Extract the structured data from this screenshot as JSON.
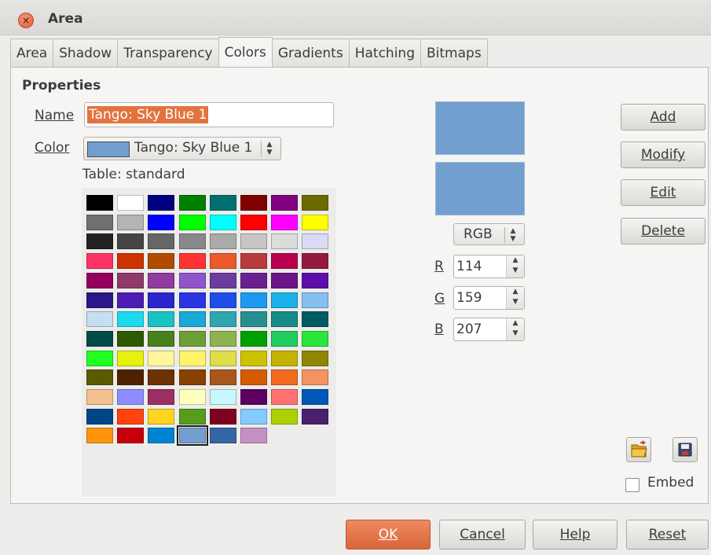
{
  "window": {
    "title": "Area"
  },
  "tabs": [
    "Area",
    "Shadow",
    "Transparency",
    "Colors",
    "Gradients",
    "Hatching",
    "Bitmaps"
  ],
  "active_tab": "Colors",
  "properties": {
    "heading": "Properties",
    "name_label": "Name",
    "name_value": "Tango: Sky Blue 1",
    "color_label": "Color",
    "color_value": "Tango: Sky Blue 1",
    "table_label": "Table: standard"
  },
  "color_model": {
    "mode": "RGB",
    "r_label": "R",
    "r_value": "114",
    "g_label": "G",
    "g_value": "159",
    "b_label": "B",
    "b_value": "207"
  },
  "preview_color": "#729fcf",
  "buttons": {
    "add": "Add",
    "modify": "Modify",
    "edit": "Edit",
    "delete": "Delete",
    "ok": "OK",
    "cancel": "Cancel",
    "help": "Help",
    "reset": "Reset"
  },
  "embed_label": "Embed",
  "palette": [
    [
      "#000000",
      "#ffffff",
      "#000080",
      "#008000",
      "#007070",
      "#800000",
      "#800080",
      "#6b6b00"
    ],
    [
      "#707070",
      "#b4b4b4",
      "#0000ff",
      "#00ff00",
      "#00ffff",
      "#ff0000",
      "#ff00ff",
      "#ffff00"
    ],
    [
      "#222222",
      "#444444",
      "#666666",
      "#888888",
      "#aaaaaa",
      "#c6c6c6",
      "#dcdcdc",
      "#dadaf5"
    ],
    [
      "#ff3366",
      "#cc3300",
      "#b04b00",
      "#ff3333",
      "#ea5a2c",
      "#b83a3a",
      "#b8004f",
      "#951a3f"
    ],
    [
      "#95005f",
      "#8f3a6b",
      "#8f3b9f",
      "#9055cc",
      "#6c3d9d",
      "#6b2091",
      "#6c148a",
      "#5e0eab"
    ],
    [
      "#2a1888",
      "#4e1bb5",
      "#2a26cc",
      "#2a34e3",
      "#1d4ee8",
      "#1d99f2",
      "#1ab2e8",
      "#84c1f0"
    ],
    [
      "#c5def1",
      "#1bd9ef",
      "#1bc2c2",
      "#1aa8d6",
      "#2ea6b0",
      "#268f92",
      "#168a86",
      "#005c63"
    ],
    [
      "#004a47",
      "#2d5a00",
      "#48811c",
      "#6d9e3a",
      "#8cb34f",
      "#00a000",
      "#1fcc5e",
      "#2ae63a"
    ],
    [
      "#22ff22",
      "#e5f20b",
      "#fff59a",
      "#fff36a",
      "#dfde4a",
      "#ccc200",
      "#c4b200",
      "#8f8700"
    ],
    [
      "#5a5a00",
      "#4e2200",
      "#6e3200",
      "#894000",
      "#a8561e",
      "#d45c00",
      "#f26a1f",
      "#f59261"
    ],
    [
      "#f2c18f",
      "#8c8cff",
      "#9c2e62",
      "#ffffc0",
      "#c8f7ff",
      "#5c0062",
      "#ff7070",
      "#0057b7"
    ],
    [
      "#004586",
      "#ff420e",
      "#ffd320",
      "#579d1c",
      "#7e0021",
      "#83caff",
      "#aecf00",
      "#4b1f6f"
    ],
    [
      "#ff950e",
      "#c5000b",
      "#0084d1",
      "#729fcf",
      "#3465a4",
      "#c590c3"
    ]
  ]
}
